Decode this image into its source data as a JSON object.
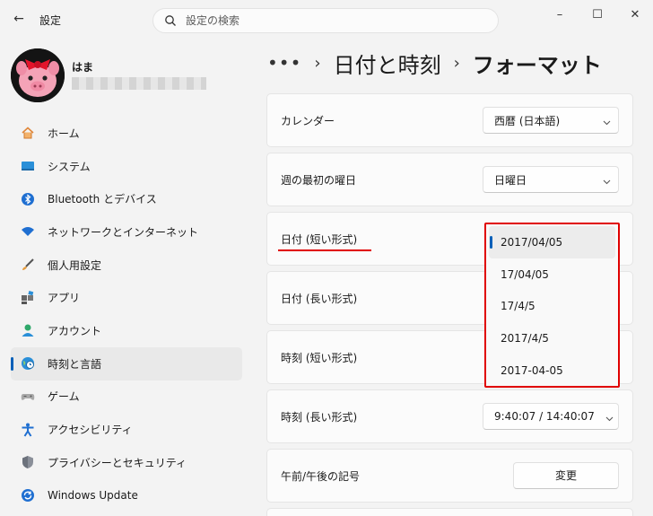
{
  "window": {
    "back_symbol": "←",
    "title": "設定",
    "minimize": "–",
    "maximize": "☐",
    "close": "✕"
  },
  "search": {
    "placeholder": "設定の検索"
  },
  "profile": {
    "name": "はま"
  },
  "sidebar": {
    "items": [
      {
        "label": "ホーム",
        "icon": "home-icon"
      },
      {
        "label": "システム",
        "icon": "system-icon"
      },
      {
        "label": "Bluetooth とデバイス",
        "icon": "bluetooth-icon"
      },
      {
        "label": "ネットワークとインターネット",
        "icon": "wifi-icon"
      },
      {
        "label": "個人用設定",
        "icon": "brush-icon"
      },
      {
        "label": "アプリ",
        "icon": "apps-icon"
      },
      {
        "label": "アカウント",
        "icon": "account-icon"
      },
      {
        "label": "時刻と言語",
        "icon": "globe-clock-icon",
        "active": true
      },
      {
        "label": "ゲーム",
        "icon": "gamepad-icon"
      },
      {
        "label": "アクセシビリティ",
        "icon": "accessibility-icon"
      },
      {
        "label": "プライバシーとセキュリティ",
        "icon": "shield-icon"
      },
      {
        "label": "Windows Update",
        "icon": "update-icon"
      }
    ]
  },
  "breadcrumb": {
    "ellipsis": "•••",
    "separator": "›",
    "parent": "日付と時刻",
    "current": "フォーマット"
  },
  "settings": {
    "calendar": {
      "label": "カレンダー",
      "value": "西暦 (日本語)"
    },
    "first_day": {
      "label": "週の最初の曜日",
      "value": "日曜日"
    },
    "short_date": {
      "label": "日付 (短い形式)"
    },
    "long_date": {
      "label": "日付 (長い形式)"
    },
    "short_time": {
      "label": "時刻 (短い形式)"
    },
    "long_time": {
      "label": "時刻 (長い形式)",
      "value": "9:40:07 / 14:40:07"
    },
    "ampm": {
      "label": "午前/午後の記号",
      "button": "変更"
    }
  },
  "short_date_options": [
    "2017/04/05",
    "17/04/05",
    "17/4/5",
    "2017/4/5",
    "2017-04-05"
  ],
  "short_date_selected_index": 0,
  "colors": {
    "accent": "#005fb8",
    "highlight": "#e00000"
  }
}
